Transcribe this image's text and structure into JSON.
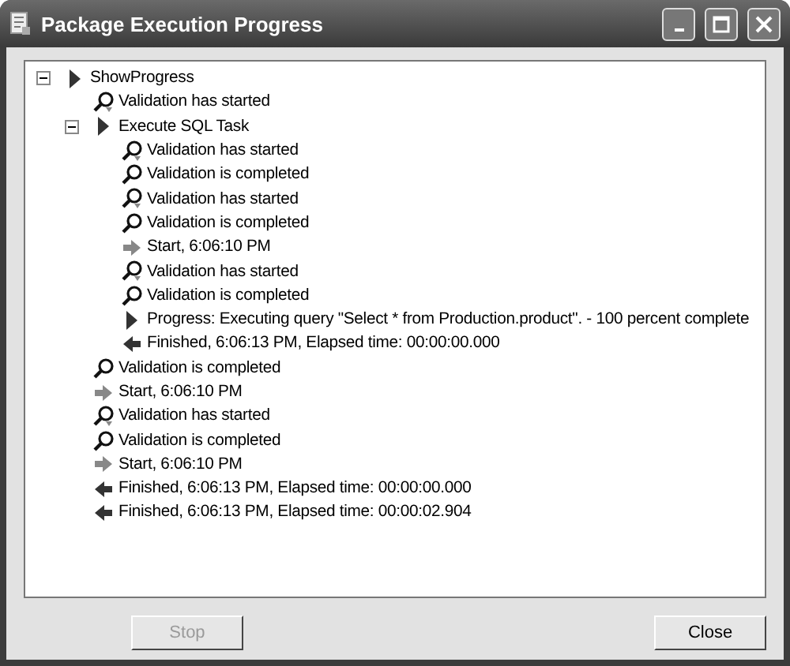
{
  "window": {
    "title": "Package Execution Progress"
  },
  "tree": [
    {
      "kind": "task",
      "label": "ShowProgress",
      "expanded": true,
      "children": [
        {
          "kind": "validation-started",
          "label": "Validation has started"
        },
        {
          "kind": "task",
          "label": "Execute SQL Task",
          "expanded": true,
          "children": [
            {
              "kind": "validation-started",
              "label": "Validation has started"
            },
            {
              "kind": "validation-completed",
              "label": "Validation is completed"
            },
            {
              "kind": "validation-started",
              "label": "Validation has started"
            },
            {
              "kind": "validation-completed",
              "label": "Validation is completed"
            },
            {
              "kind": "start",
              "label": "Start, 6:06:10 PM"
            },
            {
              "kind": "validation-started",
              "label": "Validation has started"
            },
            {
              "kind": "validation-completed",
              "label": "Validation is completed"
            },
            {
              "kind": "progress",
              "label": "Progress: Executing query \"Select * from Production.product\". - 100 percent complete"
            },
            {
              "kind": "finished",
              "label": "Finished, 6:06:13 PM, Elapsed time: 00:00:00.000"
            }
          ]
        },
        {
          "kind": "validation-completed",
          "label": "Validation is completed"
        },
        {
          "kind": "start",
          "label": "Start, 6:06:10 PM"
        },
        {
          "kind": "validation-started",
          "label": "Validation has started"
        },
        {
          "kind": "validation-completed",
          "label": "Validation is completed"
        },
        {
          "kind": "start",
          "label": "Start, 6:06:10 PM"
        },
        {
          "kind": "finished",
          "label": "Finished, 6:06:13 PM, Elapsed time: 00:00:00.000"
        },
        {
          "kind": "finished",
          "label": "Finished, 6:06:13 PM, Elapsed time: 00:00:02.904"
        }
      ]
    }
  ],
  "buttons": [
    {
      "label": "Stop",
      "disabled": true
    },
    {
      "label": "Close",
      "disabled": false
    }
  ]
}
